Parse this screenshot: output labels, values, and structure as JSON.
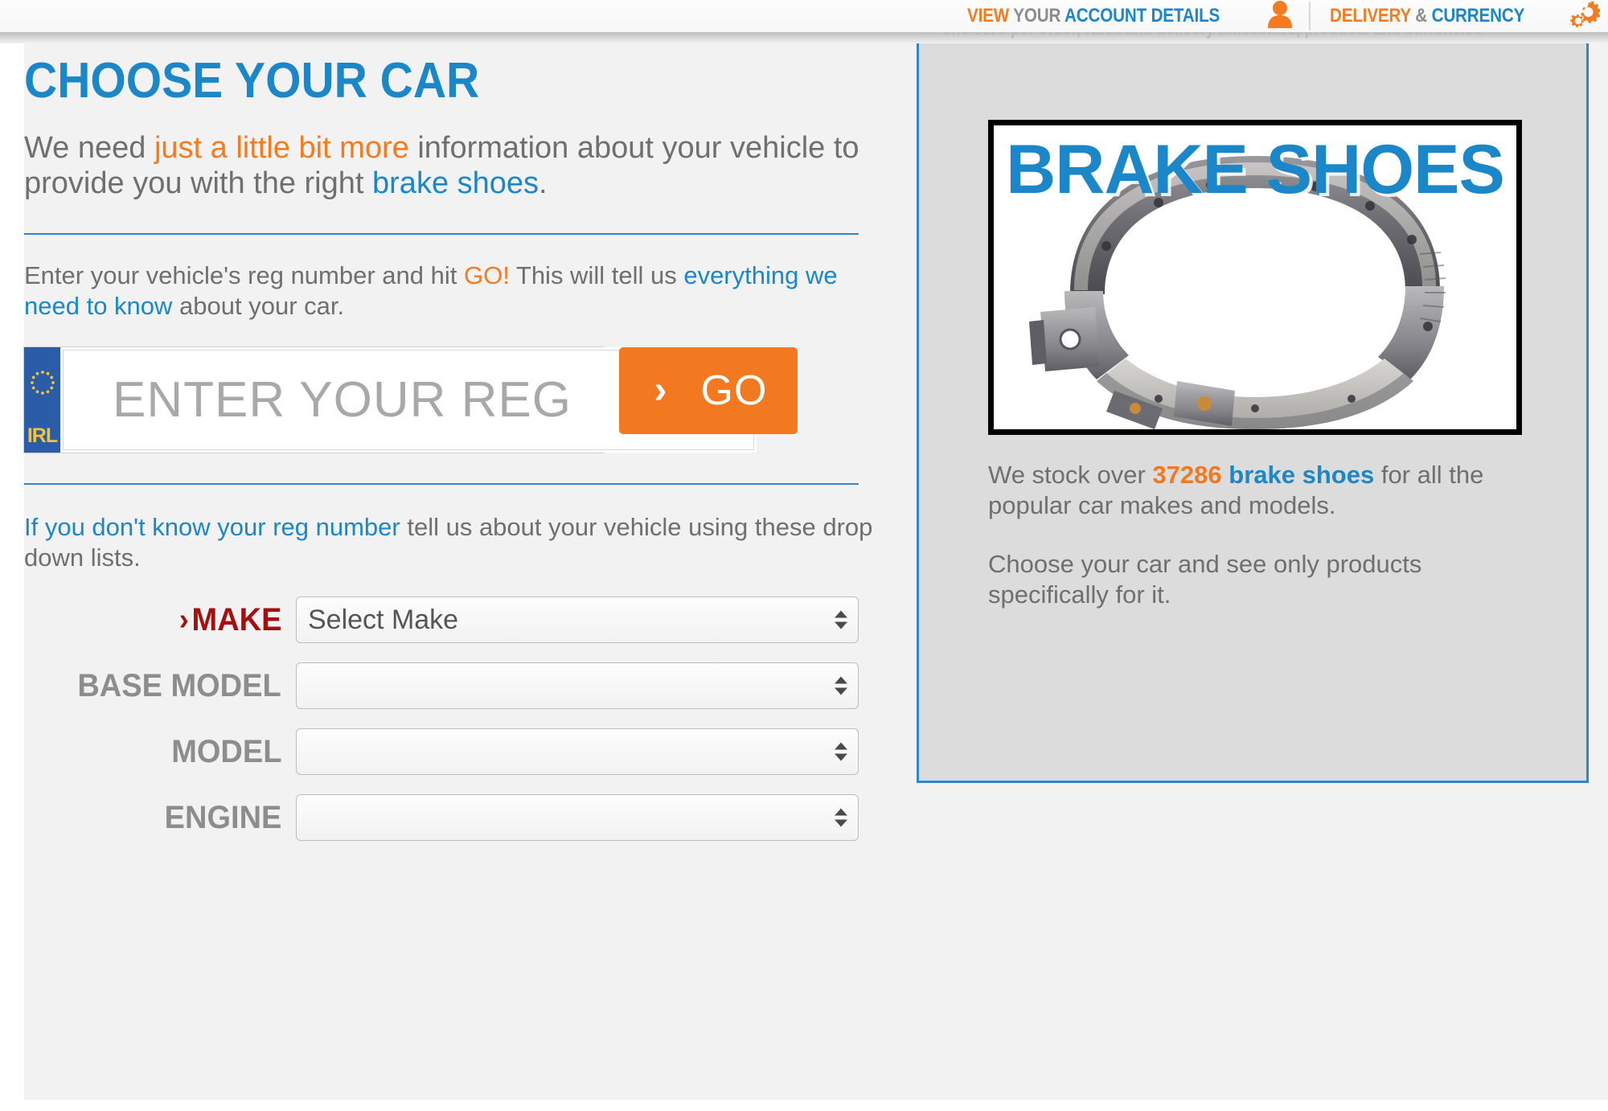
{
  "topbar": {
    "view": "VIEW",
    "your": "YOUR",
    "account_details": "ACCOUNT DETAILS",
    "delivery": "DELIVERY",
    "amp": "&",
    "currency": "CURRENCY",
    "cutoff_text": "one euro per order, rates and delivery timescales, products and currencies",
    "person_icon": "person-icon",
    "gear_icon": "gear-icon"
  },
  "main": {
    "headline": "CHOOSE YOUR CAR",
    "lede": {
      "part1": "We need ",
      "highlight": "just a little bit more",
      "part2": " information about your vehicle to provide you with the right ",
      "product_link": "brake shoes",
      "part3": "."
    },
    "reg_para": {
      "part1": "Enter your vehicle's reg number and hit ",
      "go": "GO!",
      "part2": " This will tell us ",
      "link": "everything we need to know",
      "part3": " about your car."
    },
    "reg_input": {
      "placeholder": "ENTER YOUR REG",
      "value": "",
      "badge_country": "IRL"
    },
    "go_button": {
      "chevron": "›",
      "label": "GO"
    },
    "dropdown_para": {
      "link": "If you don't know your reg number",
      "rest": " tell us about your vehicle using these drop down lists."
    },
    "selects": [
      {
        "label": "MAKE",
        "chevron": "›",
        "value": "Select Make",
        "highlight": true
      },
      {
        "label": "BASE MODEL",
        "chevron": "",
        "value": "",
        "highlight": false
      },
      {
        "label": "MODEL",
        "chevron": "",
        "value": "",
        "highlight": false
      },
      {
        "label": "ENGINE",
        "chevron": "",
        "value": "",
        "highlight": false
      }
    ]
  },
  "panel": {
    "product_banner": "BRAKE SHOES",
    "stock": {
      "part1": "We stock over ",
      "count": "37286",
      "product": "brake shoes",
      "part2": " for all the popular car makes and models."
    },
    "choose": "Choose your car and see only products specifically for it."
  },
  "colors": {
    "blue": "#1b87c9",
    "orange": "#f2791f",
    "grey": "#6f6f6f",
    "dark_red": "#a50f0f",
    "plate_blue": "#2b5ca8",
    "star_yellow": "#f3c33c"
  }
}
